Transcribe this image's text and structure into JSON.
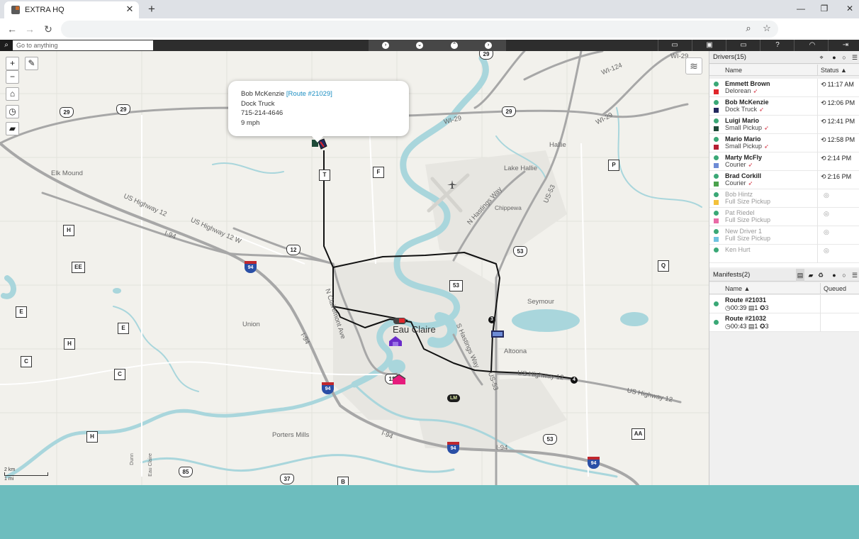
{
  "browser": {
    "tab_title": "EXTRA HQ",
    "tab_close": "✕",
    "new_tab": "+",
    "minimize": "—",
    "maximize": "❐",
    "close": "✕",
    "back": "←",
    "forward": "→",
    "reload": "↻",
    "zoom_icon": "⌕",
    "star_icon": "☆"
  },
  "appbar": {
    "search_placeholder": "Go to anything",
    "search_icon": "⌕"
  },
  "map": {
    "zoom_in": "+",
    "zoom_out": "−",
    "scale_km": "2 km",
    "scale_mi": "1 mi",
    "labels": {
      "elk_mound": "Elk Mound",
      "union": "Union",
      "porters_mills": "Porters Mills",
      "eau_claire": "Eau Claire",
      "altoona": "Altoona",
      "seymour": "Seymour",
      "lake_hallie": "Lake Hallie",
      "hallie": "Hallie",
      "chippewa": "Chippewa",
      "us12_a": "US Highway 12",
      "us12_b": "US Highway 12 W",
      "us12_c": "US Highway 12",
      "us12_d": "US Highway 12",
      "i94_a": "I-94",
      "i94_b": "I-94",
      "i94_c": "I-94",
      "i94_d": "I-94",
      "wi29_a": "WI-29",
      "wi29_b": "WI-29",
      "wi29_c": "WI-29",
      "wi124": "WI-124",
      "us53_a": "US-53",
      "us53_b": "US-53",
      "n_hastings": "N Hastings Way",
      "s_hastings": "S Hastings Way",
      "n_clairemont": "N Clairemont Ave",
      "dunn": "Dunn",
      "eau_claire_co": "Eau Claire"
    },
    "letter_shields": [
      "T",
      "F",
      "P",
      "H",
      "EE",
      "E",
      "E",
      "H",
      "C",
      "C",
      "Q",
      "AA",
      "H",
      "B"
    ],
    "route_shields": [
      "29",
      "29",
      "29",
      "29",
      "12",
      "53",
      "53",
      "53",
      "85",
      "37",
      "12"
    ],
    "interstate_shields": [
      "94",
      "94",
      "94",
      "94"
    ],
    "markers": {
      "lm_a": "LM",
      "lm_b": "LM",
      "num_3": "3",
      "num_4": "4"
    },
    "popup": {
      "driver": "Bob McKenzie",
      "route": "[Route #21029]",
      "vehicle": "Dock Truck",
      "phone": "715-214-4646",
      "speed": "9 mph"
    }
  },
  "drivers": {
    "title": "Drivers(15)",
    "col_name": "Name",
    "col_status": "Status ▲",
    "rows": [
      {
        "name": "Emmett Brown",
        "vehicle": "Delorean",
        "status": "11:17 AM",
        "color": "#e0262b",
        "active": true
      },
      {
        "name": "Bob McKenzie",
        "vehicle": "Dock Truck",
        "status": "12:06 PM",
        "color": "#23295e",
        "active": true
      },
      {
        "name": "Luigi Mario",
        "vehicle": "Small Pickup",
        "status": "12:41 PM",
        "color": "#1e4a38",
        "active": true
      },
      {
        "name": "Mario Mario",
        "vehicle": "Small Pickup",
        "status": "12:58 PM",
        "color": "#b51f33",
        "active": true
      },
      {
        "name": "Marty McFly",
        "vehicle": "Courier",
        "status": "2:14 PM",
        "color": "#6d8bd6",
        "active": true
      },
      {
        "name": "Brad Corkill",
        "vehicle": "Courier",
        "status": "2:16 PM",
        "color": "#4aa14c",
        "active": true
      },
      {
        "name": "Bob Hintz",
        "vehicle": "Full Size Pickup",
        "status": "",
        "color": "#f3c13a",
        "active": false
      },
      {
        "name": "Pat Riedel",
        "vehicle": "Full Size Pickup",
        "status": "",
        "color": "#e96aa6",
        "active": false
      },
      {
        "name": "New Driver 1",
        "vehicle": "Full Size Pickup",
        "status": "",
        "color": "#6fc3e0",
        "active": false
      },
      {
        "name": "Ken Hurt",
        "vehicle": "",
        "status": "",
        "color": "",
        "active": false
      }
    ]
  },
  "manifests": {
    "title": "Manifests(2)",
    "col_name": "Name ▲",
    "col_queued": "Queued",
    "rows": [
      {
        "name": "Route #21031",
        "time": "00:39",
        "stops": "1",
        "items": "3"
      },
      {
        "name": "Route #21032",
        "time": "00:43",
        "stops": "1",
        "items": "3"
      }
    ]
  },
  "colors": {
    "accent_link": "#1b8ec2",
    "status_online": "#3aa876",
    "route_line": "#111111",
    "water": "#a9d6dc",
    "desktop": "#6dbdbe"
  }
}
